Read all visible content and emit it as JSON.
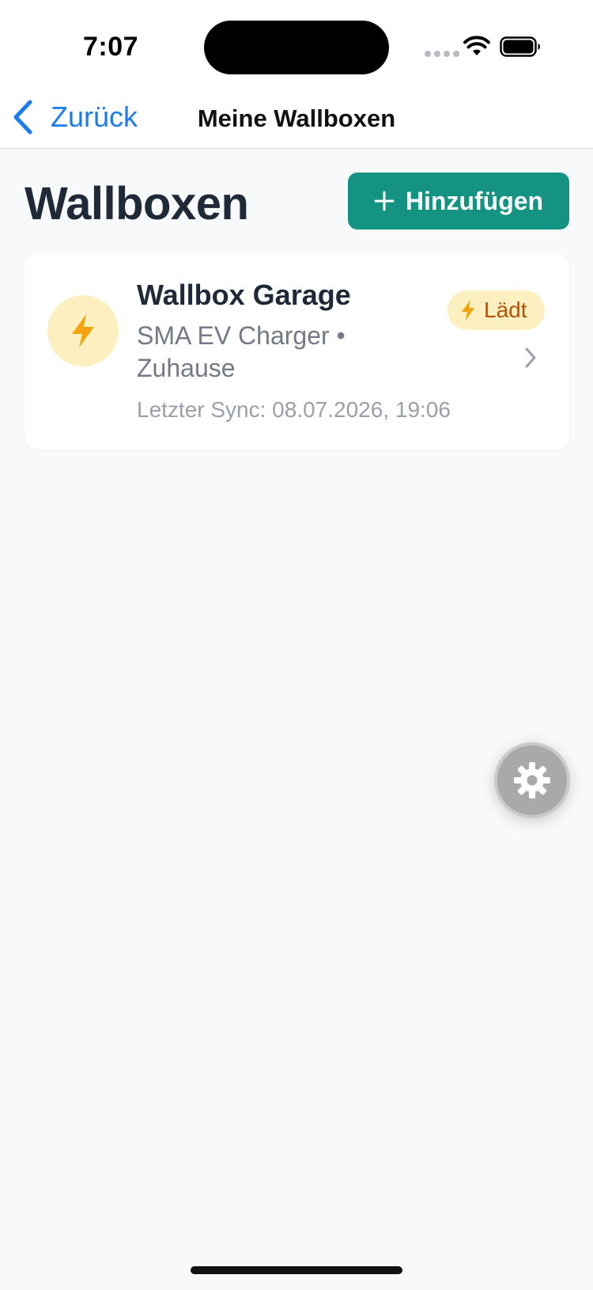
{
  "status_bar": {
    "time": "7:07",
    "icons": [
      "signal-dots-icon",
      "wifi-icon",
      "battery-icon"
    ]
  },
  "nav": {
    "back_label": "Zurück",
    "title": "Meine Wallboxen"
  },
  "header": {
    "title": "Wallboxen",
    "add_label": "Hinzufügen"
  },
  "wallboxes": [
    {
      "name": "Wallbox Garage",
      "subtitle": "SMA EV Charger • Zuhause",
      "last_sync": "Letzter Sync: 08.07.2026, 19:06",
      "status": "Lädt",
      "icon": "bolt-icon"
    }
  ],
  "colors": {
    "accent": "#149383",
    "link": "#1a7cf0",
    "badge_bg": "#fdf0c0",
    "badge_text": "#b45309",
    "bolt": "#f5a30b",
    "background": "#f8f9fb"
  }
}
